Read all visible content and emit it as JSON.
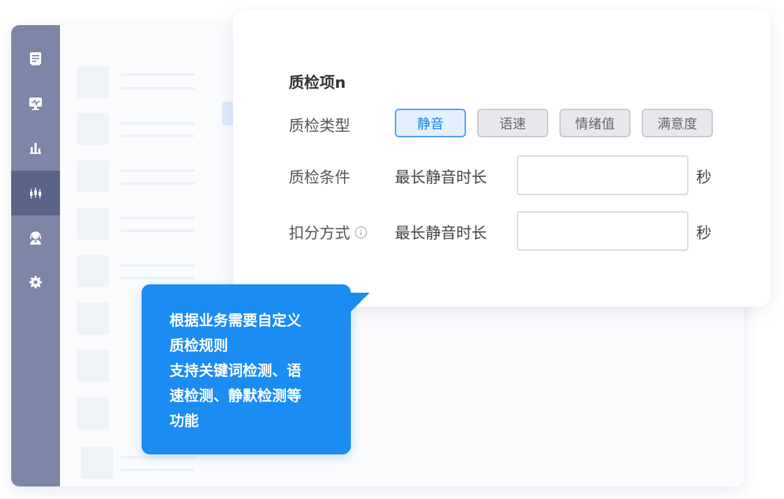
{
  "sidebar": {
    "items": [
      {
        "icon": "document-icon",
        "active": false
      },
      {
        "icon": "monitor-icon",
        "active": false
      },
      {
        "icon": "bar-chart-icon",
        "active": false
      },
      {
        "icon": "candlestick-icon",
        "active": true
      },
      {
        "icon": "agent-icon",
        "active": false
      },
      {
        "icon": "gear-icon",
        "active": false
      }
    ],
    "colors": {
      "background": "#7d86a6",
      "active": "#5a6488"
    }
  },
  "card": {
    "title": "质检项n",
    "type_label": "质检类型",
    "type_options": [
      "静音",
      "语速",
      "情绪值",
      "满意度"
    ],
    "type_selected": "静音",
    "condition_label": "质检条件",
    "condition_text": "最长静音时长",
    "condition_value": "",
    "condition_unit": "秒",
    "deduction_label": "扣分方式",
    "deduction_text": "最长静音时长",
    "deduction_value": "",
    "deduction_unit": "秒"
  },
  "tooltip": {
    "lines": [
      "根据业务需要自定义",
      "质检规则",
      "支持关键词检测、语",
      "速检测、静默检测等",
      "功能"
    ],
    "color": "#1a8cf2"
  },
  "accent": "#1a7fe7"
}
